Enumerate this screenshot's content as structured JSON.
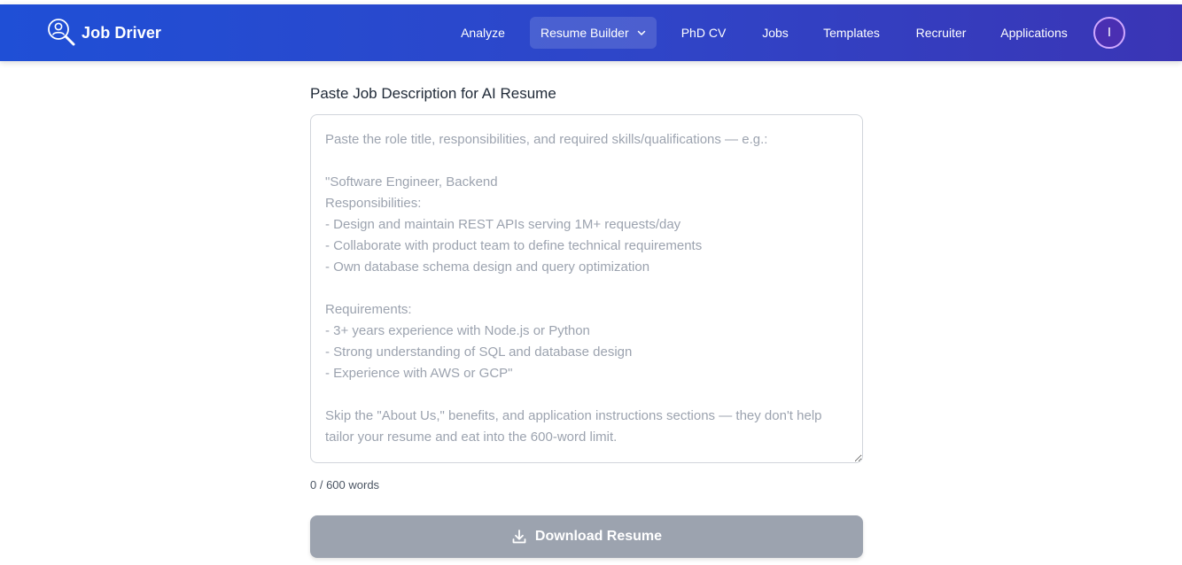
{
  "app": {
    "name": "Job Driver",
    "logo_icon": "magnifier-person-icon"
  },
  "nav": {
    "items": [
      {
        "label": "Analyze"
      },
      {
        "label": "Resume Builder",
        "active": true,
        "has_dropdown": true
      },
      {
        "label": "PhD CV"
      },
      {
        "label": "Jobs"
      },
      {
        "label": "Templates"
      },
      {
        "label": "Recruiter"
      },
      {
        "label": "Applications"
      }
    ],
    "avatar_initial": "I"
  },
  "form": {
    "label": "Paste Job Description for AI Resume",
    "value": "",
    "placeholder": "Paste the role title, responsibilities, and required skills/qualifications — e.g.:\n\n\"Software Engineer, Backend\nResponsibilities:\n- Design and maintain REST APIs serving 1M+ requests/day\n- Collaborate with product team to define technical requirements\n- Own database schema design and query optimization\n\nRequirements:\n- 3+ years experience with Node.js or Python\n- Strong understanding of SQL and database design\n- Experience with AWS or GCP\"\n\nSkip the \"About Us,\" benefits, and application instructions sections — they don't help tailor your resume and eat into the 600-word limit.",
    "word_count": "0 / 600 words",
    "download_label": "Download Resume",
    "download_icon": "download-icon",
    "download_enabled": false
  },
  "colors": {
    "nav_gradient_start": "#1f4fd6",
    "nav_gradient_end": "#3a35b5",
    "button_disabled": "#9ca3af",
    "placeholder_text": "#9ca3af"
  }
}
